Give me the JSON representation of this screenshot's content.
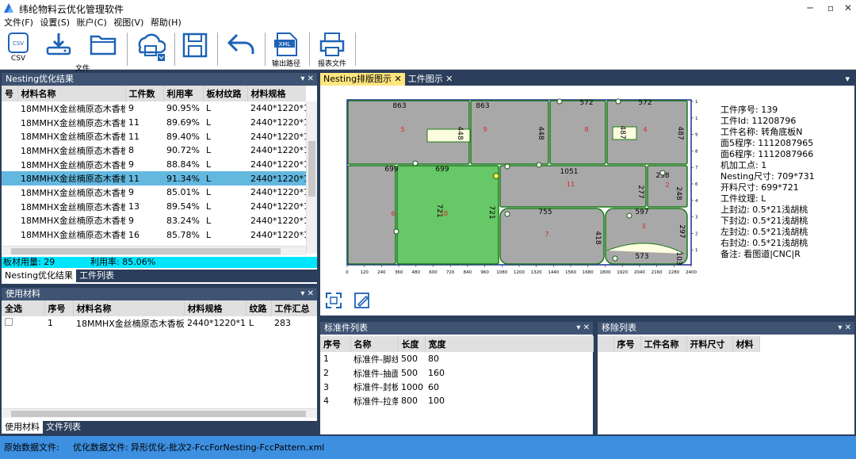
{
  "window": {
    "title": "纬纶物料云优化管理软件"
  },
  "menu": [
    "文件(F)",
    "设置(S)",
    "账户(C)",
    "视图(V)",
    "帮助(H)"
  ],
  "toolbar": {
    "csv_label": "CSV",
    "file_label": "文件",
    "cloud_label": "云",
    "save_label": "保存",
    "undo_label": "撤销",
    "xml_label": "XML",
    "output_path_label": "输出路径",
    "report_label": "报表文件"
  },
  "nesting_panel": {
    "title": "Nesting优化结果",
    "columns": [
      "号",
      "材料名称",
      "工件数",
      "利用率",
      "板材纹路",
      "材料规格"
    ],
    "rows": [
      {
        "name": "18MMHX金丝楠原态木香板",
        "count": "9",
        "rate": "90.95%",
        "grain": "L",
        "spec": "2440*1220*18"
      },
      {
        "name": "18MMHX金丝楠原态木香板",
        "count": "11",
        "rate": "89.69%",
        "grain": "L",
        "spec": "2440*1220*18"
      },
      {
        "name": "18MMHX金丝楠原态木香板",
        "count": "11",
        "rate": "89.40%",
        "grain": "L",
        "spec": "2440*1220*18"
      },
      {
        "name": "18MMHX金丝楠原态木香板",
        "count": "8",
        "rate": "90.72%",
        "grain": "L",
        "spec": "2440*1220*18"
      },
      {
        "name": "18MMHX金丝楠原态木香板",
        "count": "9",
        "rate": "88.84%",
        "grain": "L",
        "spec": "2440*1220*18"
      },
      {
        "name": "18MMHX金丝楠原态木香板",
        "count": "11",
        "rate": "91.34%",
        "grain": "L",
        "spec": "2440*1220*18"
      },
      {
        "name": "18MMHX金丝楠原态木香板",
        "count": "9",
        "rate": "85.01%",
        "grain": "L",
        "spec": "2440*1220*18"
      },
      {
        "name": "18MMHX金丝楠原态木香板",
        "count": "13",
        "rate": "89.54%",
        "grain": "L",
        "spec": "2440*1220*18"
      },
      {
        "name": "18MMHX金丝楠原态木香板",
        "count": "9",
        "rate": "83.24%",
        "grain": "L",
        "spec": "2440*1220*18"
      },
      {
        "name": "18MMHX金丝楠原态木香板",
        "count": "16",
        "rate": "85.78%",
        "grain": "L",
        "spec": "2440*1220*18"
      }
    ],
    "selected_index": 5,
    "summary_board": "板材用量:  29",
    "summary_rate": "利用率:  85.06%",
    "tabs": [
      "Nesting优化结果",
      "工件列表"
    ]
  },
  "materials_panel": {
    "title": "使用材料",
    "columns": [
      "全选",
      "序号",
      "材料名称",
      "材料规格",
      "纹路",
      "工件汇总"
    ],
    "rows": [
      {
        "idx": "1",
        "name": "18MMHX金丝楠原态木香板",
        "spec": "2440*1220*18",
        "grain": "L",
        "total": "283"
      }
    ],
    "tabs": [
      "使用材料",
      "文件列表"
    ]
  },
  "doc_tabs": [
    "Nesting排版图示",
    "工件图示"
  ],
  "nesting_view": {
    "part_dims": [
      "863",
      "863",
      "572",
      "572",
      "448",
      "448",
      "487",
      "487",
      "699",
      "699",
      "1051",
      "277",
      "298",
      "248",
      "721",
      "721",
      "755",
      "597",
      "418",
      "297",
      "573",
      "103"
    ],
    "part_ids": [
      "5",
      "9",
      "8",
      "4",
      "11",
      "2",
      "6",
      "10",
      "7",
      "3"
    ],
    "x_ticks": [
      "0",
      "120",
      "240",
      "360",
      "480",
      "600",
      "720",
      "840",
      "960",
      "1080",
      "1200",
      "1320",
      "1440",
      "1560",
      "1680",
      "1800",
      "1920",
      "2040",
      "2160",
      "2280",
      "2400"
    ],
    "y_ticks": [
      "1200",
      "1080",
      "960",
      "840",
      "720",
      "600",
      "480",
      "360",
      "240",
      "120"
    ]
  },
  "part_info": [
    "工件序号:  139",
    "工件Id:  11208796",
    "工件名称:  转角底板N",
    "面5程序:  1112087965",
    "面6程序:  1112087966",
    "机加工点:  1",
    "Nesting尺寸:  709*731",
    "开料尺寸:  699*721",
    "工件纹理:  L",
    "上封边:  0.5*21浅胡桃",
    "下封边:  0.5*21浅胡桃",
    "左封边:  0.5*21浅胡桃",
    "右封边:  0.5*21浅胡桃",
    "备注:  看图道|CNC|R"
  ],
  "standard_panel": {
    "title": "标准件列表",
    "columns": [
      "序号",
      "名称",
      "长度",
      "宽度"
    ],
    "rows": [
      {
        "idx": "1",
        "name": "标准件-脚线",
        "len": "500",
        "wid": "80"
      },
      {
        "idx": "2",
        "name": "标准件-抽面",
        "len": "500",
        "wid": "160"
      },
      {
        "idx": "3",
        "name": "标准件-封板",
        "len": "1000",
        "wid": "60"
      },
      {
        "idx": "4",
        "name": "标准件-拉条",
        "len": "800",
        "wid": "100"
      }
    ]
  },
  "remove_panel": {
    "title": "移除列表",
    "columns": [
      "序号",
      "工件名称",
      "开料尺寸",
      "材料"
    ]
  },
  "status": {
    "source_label": "原始数据文件:",
    "optimize_label": "优化数据文件:",
    "optimize_file": "异形优化-批次2-FccForNesting-FccPattern.xml"
  },
  "colors": {
    "selection": "#63b8e0",
    "summary_bg": "#00e5ff",
    "panel_header": "#3f5473",
    "status_bg": "#3d8fe0",
    "part_fill": "#a8a8a8",
    "part_highlight": "#66c866",
    "edge_green": "#1a7a1a"
  }
}
